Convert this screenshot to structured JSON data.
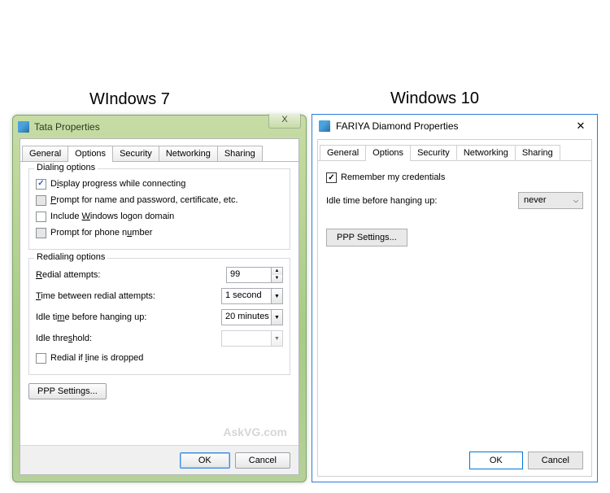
{
  "headings": {
    "win7": "WIndows 7",
    "win10": "Windows 10"
  },
  "win7": {
    "title": "Tata Properties",
    "close_glyph": "X",
    "tabs": [
      "General",
      "Options",
      "Security",
      "Networking",
      "Sharing"
    ],
    "active_tab": 1,
    "dialing": {
      "legend": "Dialing options",
      "display_progress": {
        "label_pre": "D",
        "label_u": "i",
        "label_post": "splay progress while connecting",
        "checked": true
      },
      "prompt_name": {
        "label_pre": "",
        "label_u": "P",
        "label_post": "rompt for name and password, certificate, etc.",
        "checked": false,
        "gray": true
      },
      "include_domain": {
        "label_pre": "Include ",
        "label_u": "W",
        "label_post": "indows logon domain",
        "checked": false
      },
      "prompt_phone": {
        "label_pre": "Prompt for phone n",
        "label_u": "u",
        "label_post": "mber",
        "checked": false,
        "gray": true
      }
    },
    "redialing": {
      "legend": "Redialing options",
      "attempts": {
        "label_pre": "",
        "label_u": "R",
        "label_post": "edial attempts:",
        "value": "99"
      },
      "time_between": {
        "label_pre": "",
        "label_u": "T",
        "label_post": "ime between redial attempts:",
        "value": "1 second"
      },
      "idle_hangup": {
        "label_pre": "Idle ti",
        "label_u": "m",
        "label_post": "e before hanging up:",
        "value": "20 minutes"
      },
      "idle_threshold": {
        "label_pre": "Idle thre",
        "label_u": "s",
        "label_post": "hold:",
        "value": ""
      },
      "redial_dropped": {
        "label_pre": "Redial if ",
        "label_u": "l",
        "label_post": "ine is dropped",
        "checked": false
      }
    },
    "ppp": "PPP Settings...",
    "ok": "OK",
    "cancel": "Cancel",
    "watermark": "AskVG.com"
  },
  "win10": {
    "title": "FARIYA Diamond Properties",
    "close_glyph": "✕",
    "tabs": [
      "General",
      "Options",
      "Security",
      "Networking",
      "Sharing"
    ],
    "active_tab": 1,
    "remember": {
      "label": "Remember my credentials",
      "checked": true
    },
    "idle": {
      "label": "Idle time before hanging up:",
      "value": "never"
    },
    "ppp": "PPP Settings...",
    "ok": "OK",
    "cancel": "Cancel"
  }
}
